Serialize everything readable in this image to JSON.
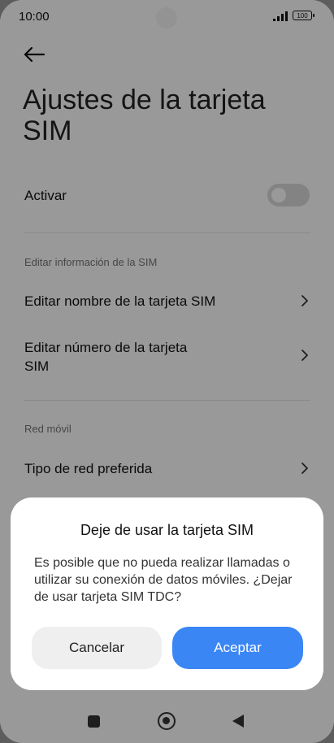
{
  "status": {
    "time": "10:00",
    "battery": "100"
  },
  "page": {
    "title": "Ajustes de la tarjeta SIM"
  },
  "settings": {
    "activate_label": "Activar",
    "section_sim_info": "Editar información de la SIM",
    "edit_name_label": "Editar nombre de la tarjeta SIM",
    "edit_number_label_line1": "Editar número de la tarjeta",
    "edit_number_label_line2": "SIM",
    "section_mobile": "Red móvil",
    "preferred_network_label": "Tipo de red preferida",
    "toggle_state": "off"
  },
  "dialog": {
    "title": "Deje de usar la tarjeta SIM",
    "message": "Es posible que no pueda realizar llamadas o utilizar su conexión de datos móviles. ¿Dejar de usar tarjeta SIM TDC?",
    "cancel_label": "Cancelar",
    "ok_label": "Aceptar"
  },
  "colors": {
    "accent": "#3a86f5",
    "scrim": "rgba(0,0,0,0.40)"
  },
  "icons": [
    "back-arrow-icon",
    "chevron-right-icon",
    "signal-icon",
    "battery-icon",
    "nav-recents-icon",
    "nav-home-icon",
    "nav-back-icon"
  ]
}
